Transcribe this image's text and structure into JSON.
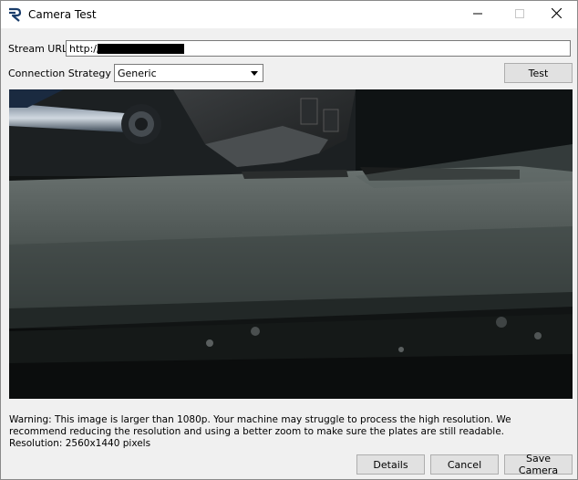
{
  "window": {
    "title": "Camera Test"
  },
  "stream_url": {
    "label": "Stream URL",
    "value": "http://"
  },
  "connection": {
    "label": "Connection Strategy",
    "selected": "Generic"
  },
  "buttons": {
    "test": "Test",
    "details": "Details",
    "cancel": "Cancel",
    "save": "Save Camera"
  },
  "warning": {
    "text": "Warning: This image is larger than 1080p.  Your machine may struggle to process the high resolution. We recommend reducing the resolution and using a better zoom to make sure the plates are still readable.",
    "resolution": "Resolution: 2560x1440 pixels"
  },
  "icons": {
    "app": "app-logo-icon",
    "minimize": "minimize-icon",
    "maximize": "maximize-icon",
    "close": "close-icon",
    "dropdown": "chevron-down-icon"
  }
}
